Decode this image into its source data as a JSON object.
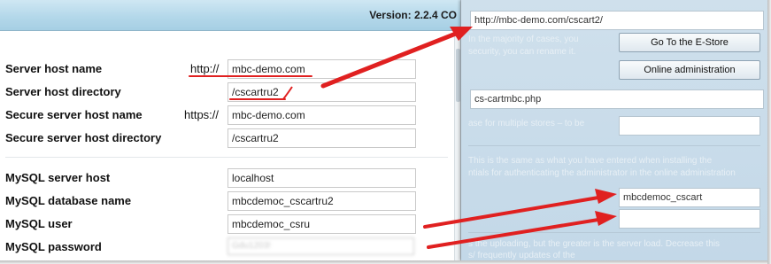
{
  "header": {
    "version": "Version: 2.2.4 CO"
  },
  "server_settings": [
    {
      "label": "Server host name",
      "prefix": "http://",
      "value": "mbc-demo.com"
    },
    {
      "label": "Server host directory",
      "prefix": "",
      "value": "/cscartru2"
    },
    {
      "label": "Secure server host name",
      "prefix": "https://",
      "value": "mbc-demo.com"
    },
    {
      "label": "Secure server host directory",
      "prefix": "",
      "value": "/cscartru2"
    }
  ],
  "mysql_settings": [
    {
      "label": "MySQL server host",
      "value": "localhost"
    },
    {
      "label": "MySQL database name",
      "value": "mbcdemoc_cscartru2"
    },
    {
      "label": "MySQL user",
      "value": "mbcdemoc_csru"
    },
    {
      "label": "MySQL password",
      "value": "Gdu1203!"
    }
  ],
  "right_panel": {
    "store_url": "http://mbc-demo.com/cscart2/",
    "hint_1": "In the majority of cases, you",
    "hint_2": "security, you can rename it.",
    "goto_button": "Go To the E-Store",
    "admin_button": "Online administration",
    "admin_script": "cs-cartmbc.php",
    "hint_3": "ase for multiple stores – to be",
    "hint_4": "This is the same as what you have entered when installing the",
    "hint_5": "ntials for authenticating the administrator in the online administration",
    "db_user": "mbcdemoc_cscart",
    "db_password": "",
    "hint_6": "s the uploading, but the greater is the server load. Decrease this",
    "hint_7": "s/ frequently updates of the"
  },
  "colors": {
    "annotation": "#e02020",
    "header_blue": "#b4d8ea",
    "panel_blue": "#c8dbe9"
  }
}
